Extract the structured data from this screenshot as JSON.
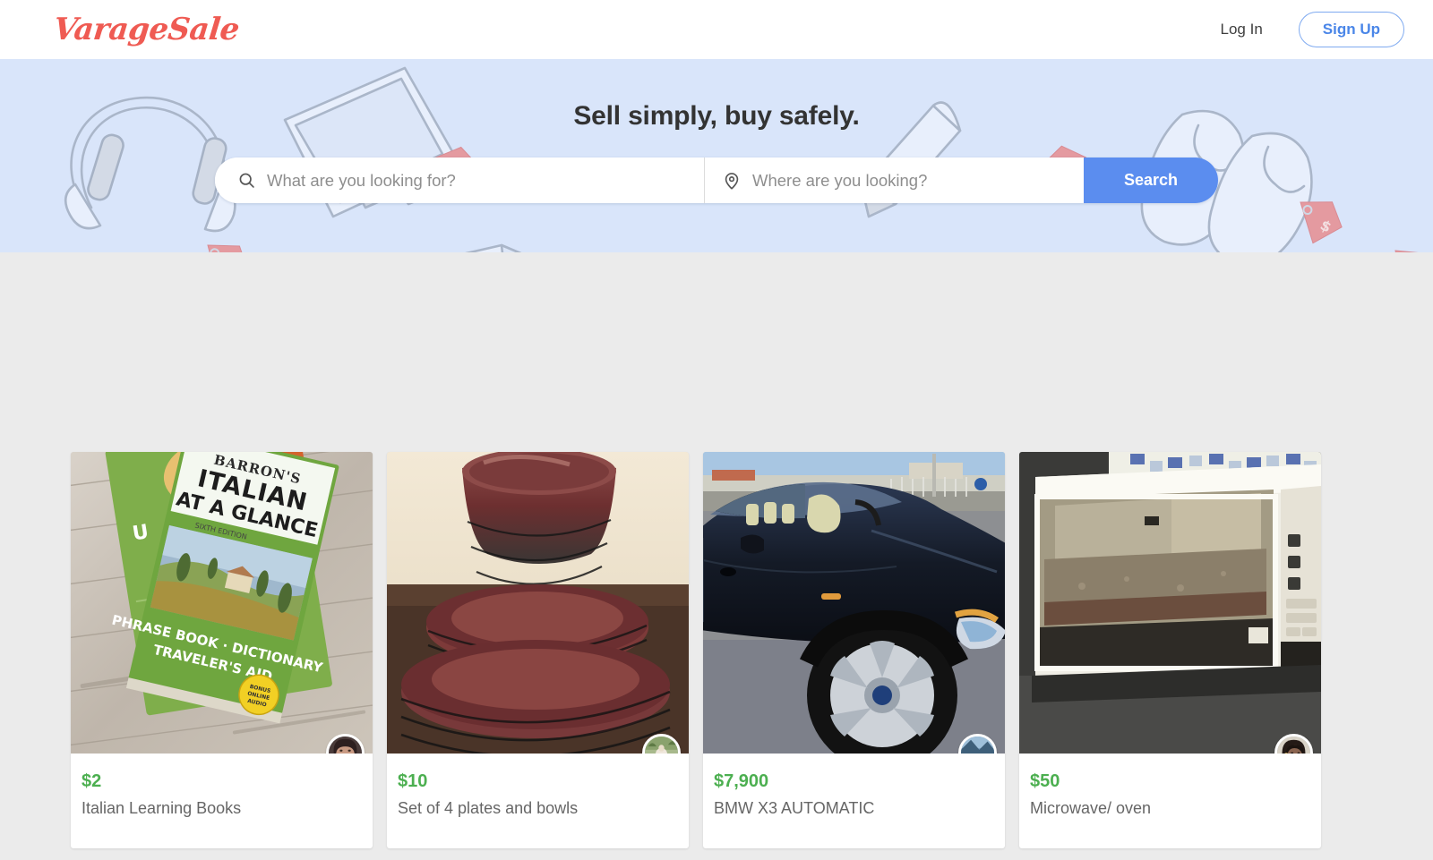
{
  "header": {
    "logo_text": "VarageSale",
    "login_label": "Log In",
    "signup_label": "Sign Up"
  },
  "hero": {
    "tagline": "Sell simply, buy safely.",
    "query_placeholder": "What are you looking for?",
    "query_value": "",
    "location_placeholder": "Where are you looking?",
    "location_value": "",
    "search_label": "Search",
    "background_color": "#d9e5fa",
    "search_button_color": "#5b8def"
  },
  "colors": {
    "brand_red": "#ef5b53",
    "accent_blue": "#4a86e8",
    "price_green": "#4caf50",
    "page_background": "#ebebeb"
  },
  "listings": [
    {
      "price": "$2",
      "title": "Italian Learning Books",
      "image_alt": "barrons-italian-at-a-glance-book-on-wood",
      "avatar_alt": "seller-avatar-photo"
    },
    {
      "price": "$10",
      "title": "Set of 4 plates and bowls",
      "image_alt": "stack-of-red-and-black-plates-and-bowls",
      "avatar_alt": "seller-avatar-photo"
    },
    {
      "price": "$7,900",
      "title": "BMW X3 AUTOMATIC",
      "image_alt": "dark-blue-bmw-x3-suv-in-parking-lot",
      "avatar_alt": "seller-avatar-photo"
    },
    {
      "price": "$50",
      "title": "Microwave/ oven",
      "image_alt": "white-microwave-oven-on-floor",
      "avatar_alt": "seller-avatar-photo"
    }
  ]
}
